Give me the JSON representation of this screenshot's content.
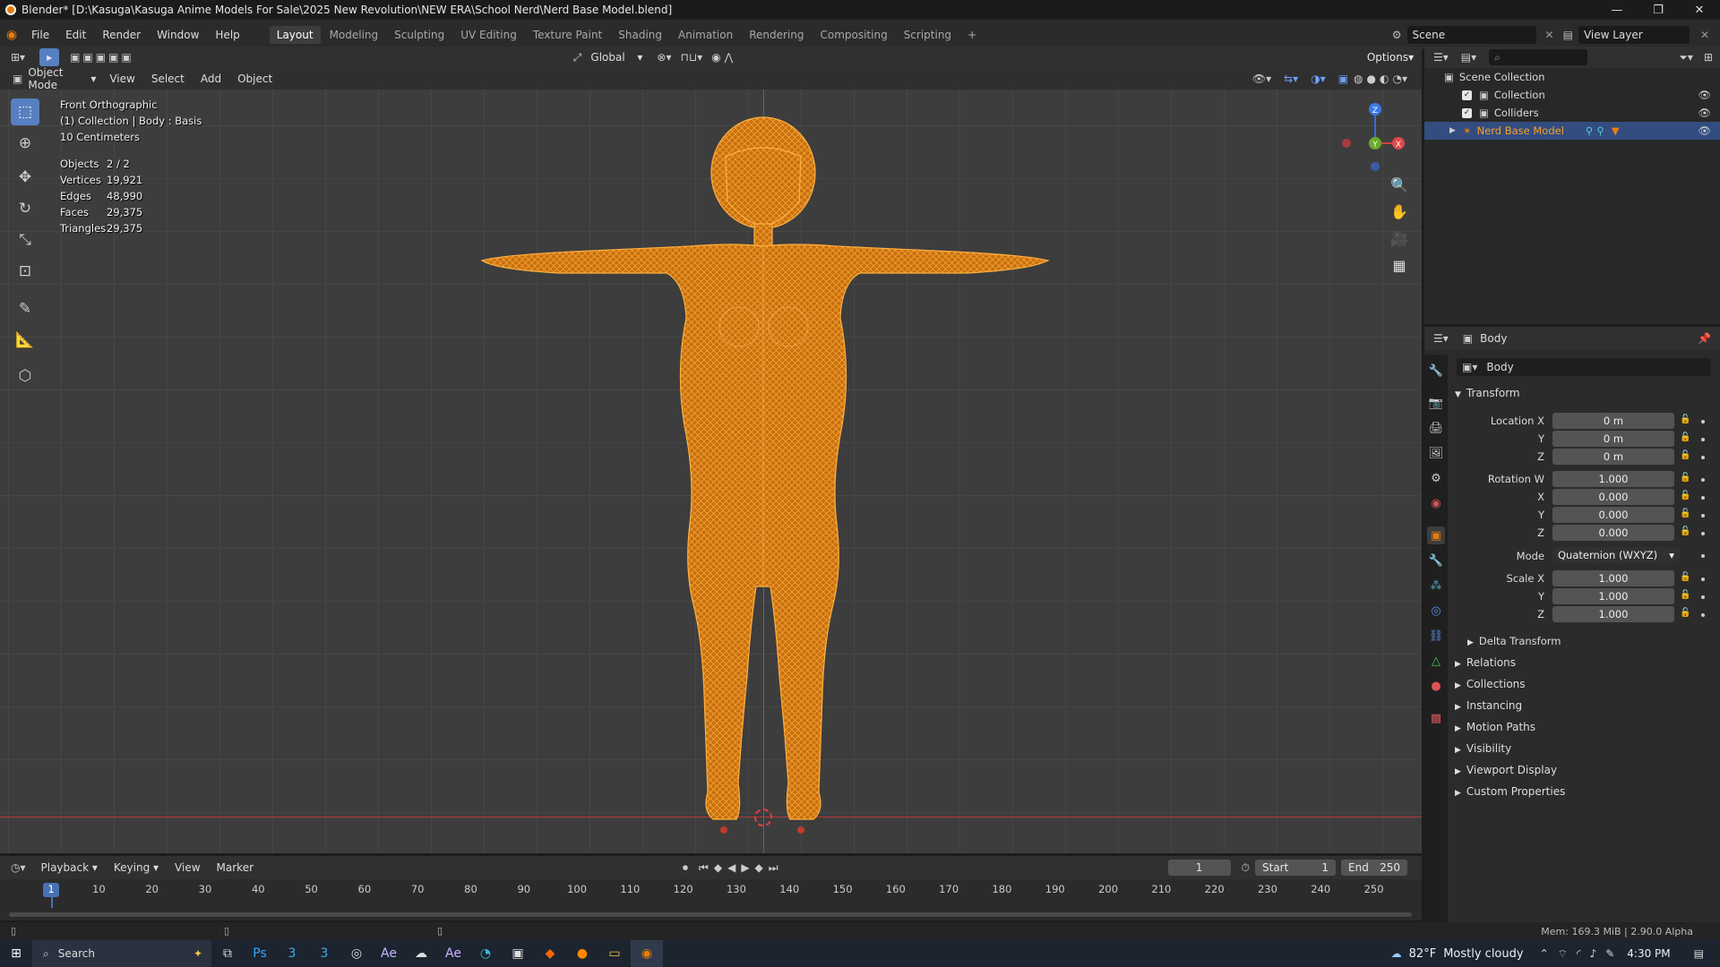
{
  "window": {
    "title": "Blender* [D:\\Kasuga\\Kasuga Anime Models For Sale\\2025 New Revolution\\NEW ERA\\School Nerd\\Nerd Base Model.blend]",
    "minimize": "—",
    "maximize": "❐",
    "close": "✕"
  },
  "menus": [
    "File",
    "Edit",
    "Render",
    "Window",
    "Help"
  ],
  "workspaces": [
    "Layout",
    "Modeling",
    "Sculpting",
    "UV Editing",
    "Texture Paint",
    "Shading",
    "Animation",
    "Rendering",
    "Compositing",
    "Scripting"
  ],
  "add_workspace": "+",
  "scene": {
    "label": "Scene",
    "view_layer": "View Layer"
  },
  "viewport_header": {
    "transform_orientation": "Global",
    "options": "Options",
    "mode": "Object Mode",
    "menus": [
      "View",
      "Select",
      "Add",
      "Object"
    ]
  },
  "overlay_info": {
    "view": "Front Orthographic",
    "collection": "(1) Collection | Body : Basis",
    "scale": "10 Centimeters",
    "stats": [
      [
        "Objects",
        "2 / 2"
      ],
      [
        "Vertices",
        "19,921"
      ],
      [
        "Edges",
        "48,990"
      ],
      [
        "Faces",
        "29,375"
      ],
      [
        "Triangles",
        "29,375"
      ]
    ]
  },
  "gizmo": {
    "z": "Z",
    "y": "Y",
    "x": "X"
  },
  "outliner": {
    "root": "Scene Collection",
    "items": [
      "Collection",
      "Colliders",
      "Nerd Base Model"
    ]
  },
  "properties": {
    "object_name": "Body",
    "data_name": "Body",
    "transform_header": "Transform",
    "location": [
      [
        "Location X",
        "0 m"
      ],
      [
        "Y",
        "0 m"
      ],
      [
        "Z",
        "0 m"
      ]
    ],
    "rotation": [
      [
        "Rotation W",
        "1.000"
      ],
      [
        "X",
        "0.000"
      ],
      [
        "Y",
        "0.000"
      ],
      [
        "Z",
        "0.000"
      ]
    ],
    "mode_label": "Mode",
    "mode_value": "Quaternion (WXYZ)",
    "scale": [
      [
        "Scale X",
        "1.000"
      ],
      [
        "Y",
        "1.000"
      ],
      [
        "Z",
        "1.000"
      ]
    ],
    "delta": "Delta Transform",
    "panels": [
      "Relations",
      "Collections",
      "Instancing",
      "Motion Paths",
      "Visibility",
      "Viewport Display",
      "Custom Properties"
    ]
  },
  "timeline": {
    "menus": [
      "Playback",
      "Keying",
      "View",
      "Marker"
    ],
    "current_frame": "1",
    "start_label": "Start",
    "start": "1",
    "end_label": "End",
    "end": "250",
    "ticks": [
      "1",
      "10",
      "20",
      "30",
      "40",
      "50",
      "60",
      "70",
      "80",
      "90",
      "100",
      "110",
      "120",
      "130",
      "140",
      "150",
      "160",
      "170",
      "180",
      "190",
      "200",
      "210",
      "220",
      "230",
      "240",
      "250"
    ]
  },
  "status": {
    "memory": "Mem: 169.3 MiB | 2.90.0 Alpha"
  },
  "taskbar": {
    "search": "Search",
    "weather_temp": "82°F",
    "weather": "Mostly cloudy",
    "time": "4:30 PM"
  },
  "colors": {
    "accent": "#e87d0d",
    "selection": "#f5a02a",
    "active_tab": "#5680c2"
  }
}
